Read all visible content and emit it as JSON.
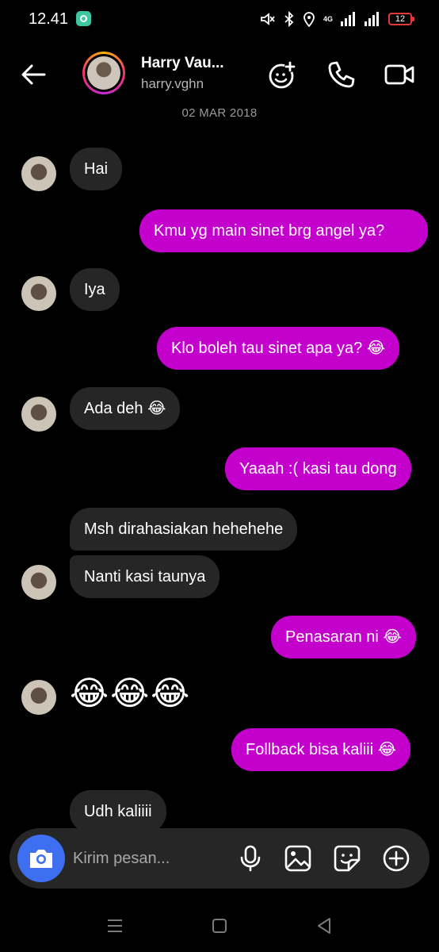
{
  "status_bar": {
    "time": "12.41",
    "network": "4G",
    "battery": "12"
  },
  "header": {
    "contact_name": "Harry Vau...",
    "username": "harry.vghn",
    "date_divider": "02 MAR 2018"
  },
  "messages": [
    {
      "text": "Hai",
      "direction": "received"
    },
    {
      "text": "Kmu yg main sinet brg angel ya?",
      "direction": "sent"
    },
    {
      "text": "Iya",
      "direction": "received"
    },
    {
      "text": "Klo boleh tau sinet apa ya? 😂",
      "direction": "sent"
    },
    {
      "text": "Ada deh 😂",
      "direction": "received"
    },
    {
      "text": "Yaaah :( kasi tau dong",
      "direction": "sent"
    },
    {
      "text": "Msh dirahasiakan hehehehe",
      "direction": "received"
    },
    {
      "text": "Nanti kasi taunya",
      "direction": "received"
    },
    {
      "text": "Penasaran ni 😂",
      "direction": "sent"
    },
    {
      "text": "😂😂😂",
      "direction": "received"
    },
    {
      "text": "Follback bisa kaliii 😂",
      "direction": "sent"
    },
    {
      "text": "Udh kaliiii",
      "direction": "received"
    }
  ],
  "composer": {
    "placeholder": "Kirim pesan..."
  },
  "colors": {
    "sent_bubble": "#c300cc",
    "received_bubble": "#262626",
    "camera_button": "#3d6ff0",
    "background": "#000000"
  },
  "icons": [
    "back-arrow-icon",
    "effects-icon",
    "phone-icon",
    "video-camera-icon",
    "camera-icon",
    "microphone-icon",
    "gallery-icon",
    "sticker-icon",
    "plus-icon",
    "nav-menu-icon",
    "nav-home-icon",
    "nav-back-icon"
  ]
}
